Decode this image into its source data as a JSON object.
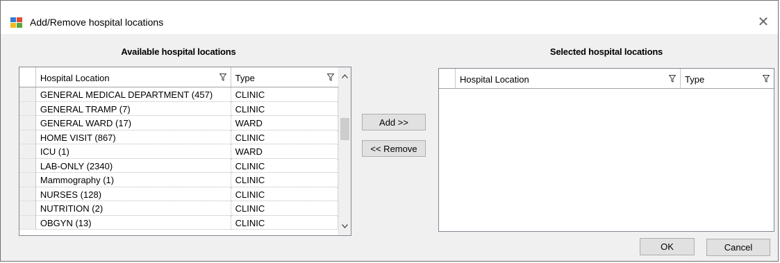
{
  "window": {
    "title": "Add/Remove hospital locations",
    "close_glyph": "✕"
  },
  "available": {
    "title": "Available hospital locations",
    "columns": [
      "Hospital Location",
      "Type"
    ],
    "rows": [
      [
        "GENERAL MEDICAL DEPARTMENT (457)",
        "CLINIC"
      ],
      [
        "GENERAL TRAMP (7)",
        "CLINIC"
      ],
      [
        "GENERAL WARD (17)",
        "WARD"
      ],
      [
        "HOME VISIT (867)",
        "CLINIC"
      ],
      [
        "ICU (1)",
        "WARD"
      ],
      [
        "LAB-ONLY (2340)",
        "CLINIC"
      ],
      [
        "Mammography (1)",
        "CLINIC"
      ],
      [
        "NURSES (128)",
        "CLINIC"
      ],
      [
        "NUTRITION (2)",
        "CLINIC"
      ],
      [
        "OBGYN (13)",
        "CLINIC"
      ]
    ]
  },
  "selected": {
    "title": "Selected hospital locations",
    "columns": [
      "Hospital Location",
      "Type"
    ],
    "rows": []
  },
  "buttons": {
    "add": "Add >>",
    "remove": "<< Remove",
    "ok": "OK",
    "cancel": "Cancel"
  },
  "icons": {
    "app": "app-window-icon",
    "filter": "filter-icon",
    "scroll_up": "chevron-up-icon",
    "scroll_down": "chevron-down-icon"
  }
}
